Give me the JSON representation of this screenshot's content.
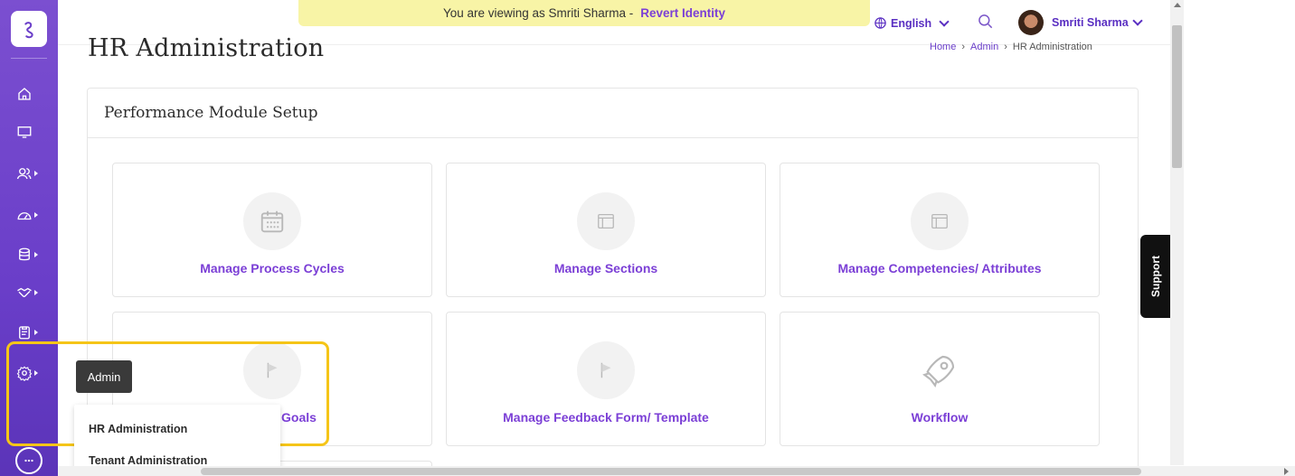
{
  "header": {
    "identity_text": "You are viewing as Smriti Sharma -",
    "revert_label": "Revert Identity",
    "language": "English",
    "user_name": "Smriti Sharma"
  },
  "page": {
    "title": "HR Administration",
    "breadcrumb": [
      "Home",
      "Admin",
      "HR Administration"
    ]
  },
  "panel": {
    "title": "Performance Module Setup",
    "cards": [
      {
        "label": "Manage Process Cycles",
        "icon": "calendar-icon"
      },
      {
        "label": "Manage Sections",
        "icon": "layout-icon"
      },
      {
        "label": "Manage Competencies/ Attributes",
        "icon": "layout-icon"
      },
      {
        "label": "Goals",
        "icon": "flag-icon"
      },
      {
        "label": "Manage Feedback Form/ Template",
        "icon": "flag-icon"
      },
      {
        "label": "Workflow",
        "icon": "rocket-icon"
      }
    ]
  },
  "admin_menu": {
    "tooltip": "Admin",
    "items": [
      "HR Administration",
      "Tenant Administration"
    ]
  },
  "support_label": "Support",
  "colors": {
    "sidebar": "#6a3ec9",
    "accent": "#7b3fd6",
    "identity_bar": "#f8f4a6",
    "highlight": "#f5c518"
  }
}
